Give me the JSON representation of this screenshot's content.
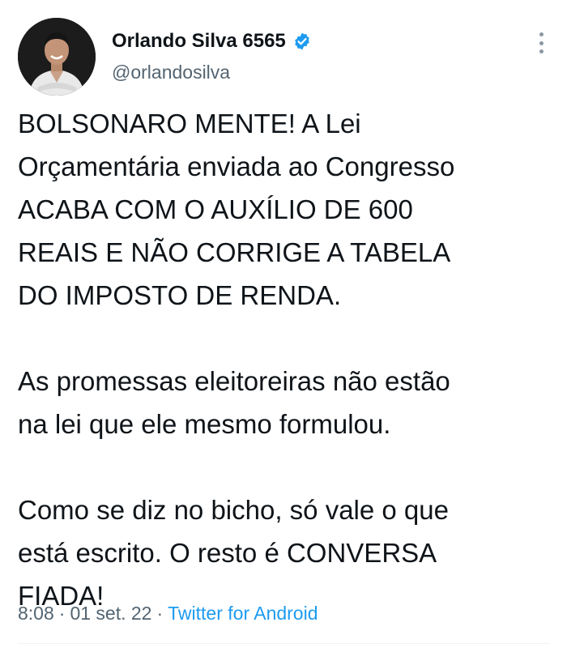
{
  "author": {
    "display_name": "Orlando Silva 6565",
    "handle": "@orlandosilva",
    "verified_icon": "verified-badge-icon",
    "avatar": "profile-photo"
  },
  "tweet": {
    "paragraphs": [
      [
        "BOLSONARO MENTE! A Lei",
        "Orçamentária enviada ao Congresso",
        "ACABA COM O AUXÍLIO DE 600",
        "REAIS E NÃO CORRIGE A TABELA",
        "DO IMPOSTO DE RENDA."
      ],
      [
        "As promessas eleitoreiras não estão",
        "na lei que ele mesmo formulou."
      ],
      [
        "Como se diz no bicho, só vale o que",
        "está escrito. O resto é CONVERSA",
        "FIADA!"
      ]
    ]
  },
  "meta": {
    "time": "8:08",
    "separator": "·",
    "date": "01 set. 22",
    "source": "Twitter for Android"
  },
  "colors": {
    "accent": "#1d9bf0",
    "secondary_text": "#536471",
    "primary_text": "#0f1419"
  },
  "icons": {
    "more": "more-vertical-icon"
  }
}
